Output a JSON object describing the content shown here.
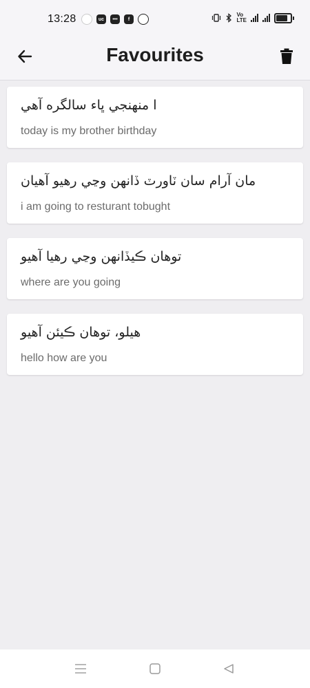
{
  "status_bar": {
    "time": "13:28",
    "left_icons": [
      "notification-dot-icon",
      "uc-browser-icon",
      "message-icon",
      "flipboard-icon",
      "spotify-icon"
    ],
    "right_icons": [
      "vibrate-icon",
      "bluetooth-icon",
      "volte-icon",
      "signal-icon",
      "signal-icon",
      "battery-icon"
    ]
  },
  "header": {
    "title": "Favourites",
    "back_icon": "arrow-left-icon",
    "delete_icon": "trash-icon"
  },
  "favourites": [
    {
      "sindhi": "ا منهنجي ڀاء سالگره آهي",
      "english": "today is my brother birthday"
    },
    {
      "sindhi": "مان آرام سان ٽاورٽ ڏانهن وڃي رهيو آهيان",
      "english": "i am going to resturant tobught"
    },
    {
      "sindhi": "توهان ڪيڏانهن وڃي رهيا آهيو",
      "english": "where are you going"
    },
    {
      "sindhi": "هيلو، توهان ڪيئن آهيو",
      "english": "hello how are you"
    }
  ],
  "nav_bar": {
    "icons": [
      "menu-icon",
      "home-square-icon",
      "back-triangle-icon"
    ]
  },
  "colors": {
    "background": "#efeef1",
    "card": "#ffffff",
    "title": "#1e1e1e",
    "subtext": "#6b6b6b"
  }
}
